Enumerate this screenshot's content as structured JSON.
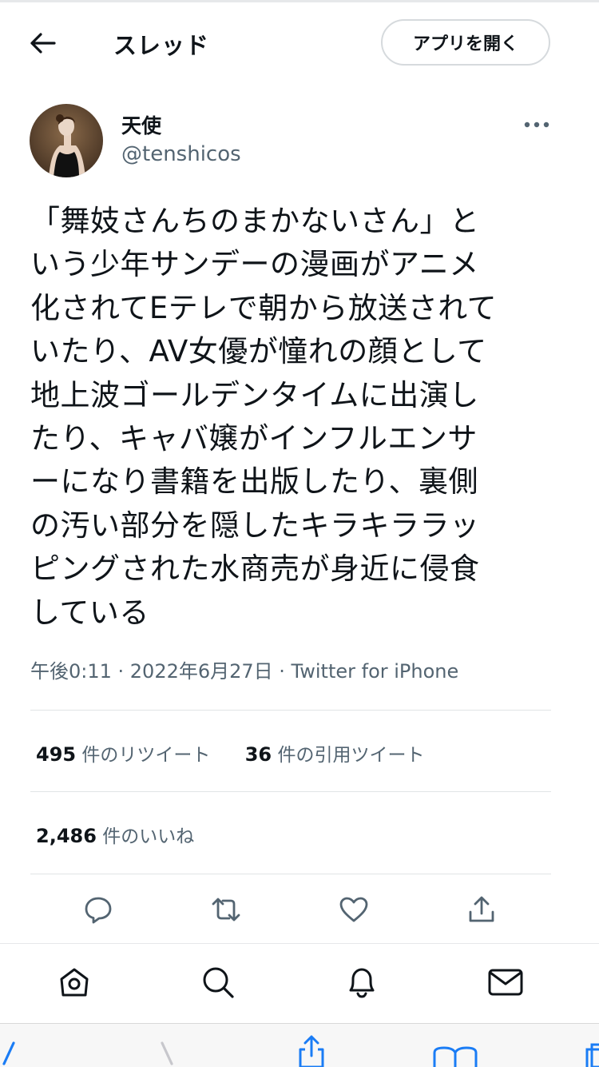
{
  "header": {
    "title": "スレッド",
    "open_app_label": "アプリを開く",
    "back_icon": "back-arrow-icon"
  },
  "tweet": {
    "author_name": "天使",
    "author_handle": "@tenshicos",
    "text": "「舞妓さんちのまかないさん」と\nいう少年サンデーの漫画がアニメ\n化されてEテレで朝から放送されて\nいたり、AV女優が憧れの顔として\n地上波ゴールデンタイムに出演し\nたり、キャバ嬢がインフルエンサ\nーになり書籍を出版したり、裏側\nの汚い部分を隠したキラキララッ\nピングされた水商売が身近に侵食\nしている",
    "timestamp": "午後0:11 · 2022年6月27日 · Twitter for iPhone"
  },
  "stats": {
    "retweets_count": "495",
    "retweets_label": "件のリツイート",
    "quotes_count": "36",
    "quotes_label": "件の引用ツイート",
    "likes_count": "2,486",
    "likes_label": "件のいいね"
  },
  "actions": [
    "reply-icon",
    "retweet-icon",
    "like-icon",
    "share-icon"
  ],
  "bottom_nav": [
    "home-icon",
    "search-icon",
    "notifications-icon",
    "messages-icon"
  ],
  "colors": {
    "text_primary": "#0f1419",
    "text_secondary": "#536471",
    "border": "#e1e4e6",
    "safari_tint": "#1a7cf5"
  }
}
